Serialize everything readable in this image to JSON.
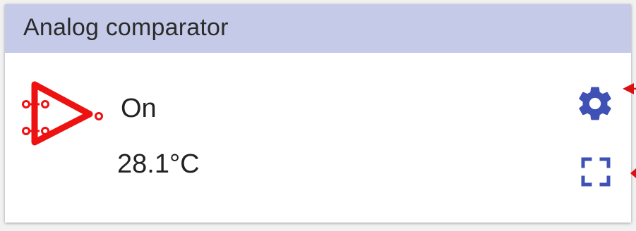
{
  "widget": {
    "title": "Analog comparator",
    "status": "On",
    "temperature": "28.1°C"
  },
  "icons": {
    "device": "comparator-icon",
    "settings": "gear-icon",
    "fullscreen": "fullscreen-icon"
  },
  "colors": {
    "header_bg": "#c5cae9",
    "accent": "#3f51b5",
    "device_icon": "#ee1111",
    "annotation": "#dd1111"
  }
}
